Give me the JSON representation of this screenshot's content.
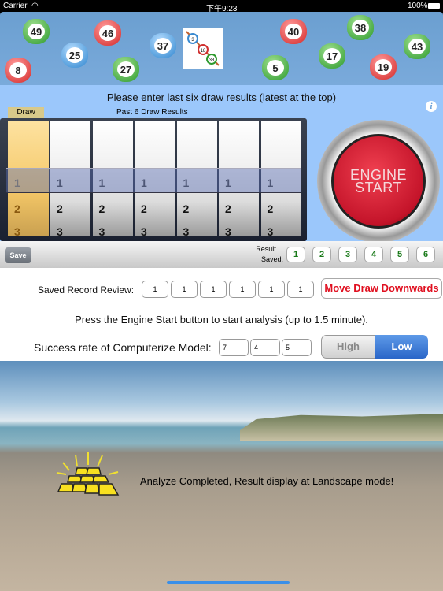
{
  "status_bar": {
    "carrier": "Carrier",
    "time": "下午9:23",
    "battery": "100%"
  },
  "banner": {
    "balls": [
      {
        "n": "49",
        "color": "green"
      },
      {
        "n": "46",
        "color": "red"
      },
      {
        "n": "25",
        "color": "blue"
      },
      {
        "n": "37",
        "color": "blue"
      },
      {
        "n": "8",
        "color": "red"
      },
      {
        "n": "27",
        "color": "green"
      },
      {
        "n": "40",
        "color": "red"
      },
      {
        "n": "38",
        "color": "green"
      },
      {
        "n": "43",
        "color": "green"
      },
      {
        "n": "17",
        "color": "green"
      },
      {
        "n": "5",
        "color": "green"
      },
      {
        "n": "19",
        "color": "red"
      }
    ],
    "logo_balls": [
      "3",
      "18",
      "38"
    ]
  },
  "instruction": "Please enter last six draw results (latest at the top)",
  "picker": {
    "draw_label": "Draw",
    "results_label": "Past 6 Draw Results",
    "draw_column": [
      "1",
      "2",
      "3"
    ],
    "columns": [
      [
        "1",
        "2",
        "3"
      ],
      [
        "1",
        "2",
        "3"
      ],
      [
        "1",
        "2",
        "3"
      ],
      [
        "1",
        "2",
        "3"
      ],
      [
        "1",
        "2",
        "3"
      ],
      [
        "1",
        "2",
        "3"
      ]
    ]
  },
  "engine_button": {
    "line1": "ENGINE",
    "line2": "START"
  },
  "save_bar": {
    "save": "Save",
    "result_label_1": "Result",
    "result_label_2": "Saved:",
    "results": [
      "1",
      "2",
      "3",
      "4",
      "5",
      "6"
    ]
  },
  "review": {
    "label": "Saved Record Review:",
    "values": [
      "1",
      "1",
      "1",
      "1",
      "1",
      "1"
    ],
    "move_button": "Move Draw Downwards"
  },
  "hint": "Press the Engine Start button to start analysis (up to 1.5 minute).",
  "success": {
    "label": "Success rate of Computerize Model:",
    "values": [
      "7",
      "4",
      "5"
    ],
    "high": "High",
    "low": "Low",
    "selected": "Low"
  },
  "completed": "Analyze Completed, Result display at Landscape mode!",
  "colors": {
    "accent": "#2a66c8",
    "warning": "#e01020",
    "banner": "#6b9fd0",
    "panel": "#9bc7fb"
  }
}
